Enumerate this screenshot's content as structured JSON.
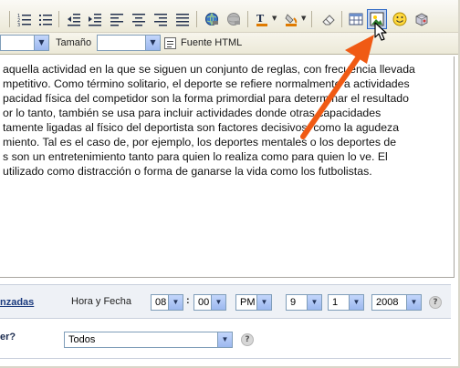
{
  "toolbar": {
    "icons": [
      "numbered-list-icon",
      "bullet-list-icon",
      "outdent-icon",
      "indent-icon",
      "align-left-icon",
      "align-center-icon",
      "align-right-icon",
      "justify-icon",
      "insert-link-icon",
      "remove-link-icon",
      "text-color-icon",
      "background-color-icon",
      "eraser-icon",
      "table-icon",
      "insert-image-icon",
      "smiley-icon",
      "attachment-icon"
    ],
    "size_label": "Tamaño",
    "html_label": "Fuente HTML"
  },
  "editor": {
    "lines": [
      "aquella actividad en la que se siguen un conjunto de reglas, con frecuencia llevada",
      "mpetitivo. Como término solitario, el deporte se refiere normalmente a actividades",
      "pacidad física del competidor son la forma primordial para determinar el resultado",
      "or lo tanto, también se usa para incluir actividades donde otras capacidades",
      "tamente ligadas al físico del deportista son factores decisivos, como la agudeza",
      "miento. Tal es el caso de, por ejemplo, los deportes mentales o los deportes de",
      "s son un entretenimiento tanto para quien lo realiza como para quien lo ve. El",
      " utilizado como distracción o forma de ganarse la vida como los futbolistas."
    ]
  },
  "advanced": {
    "link_text": "nzadas",
    "datetime_label": "Hora y Fecha",
    "hour": "08",
    "minute": "00",
    "ampm": "PM",
    "month": "9",
    "day": "1",
    "year": "2008",
    "help": "?"
  },
  "visibility": {
    "question": "er?",
    "value": "Todos",
    "help": "?"
  },
  "colors": {
    "arrow": "#f05a14",
    "highlight": "#316ac5"
  }
}
